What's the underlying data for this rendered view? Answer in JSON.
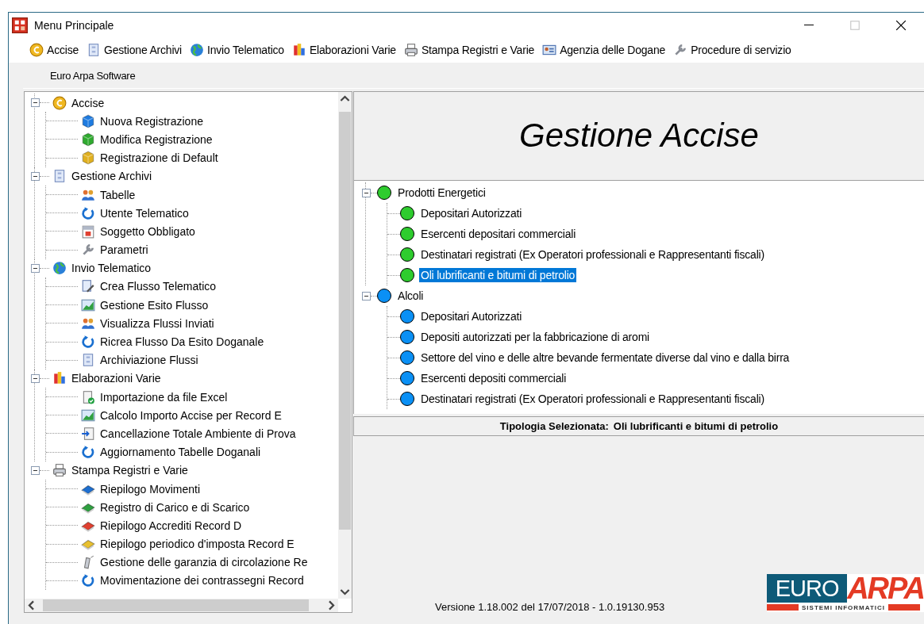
{
  "window": {
    "title": "Menu Principale"
  },
  "menu": [
    "Accise",
    "Gestione Archivi",
    "Invio Telematico",
    "Elaborazioni Varie",
    "Stampa Registri e Varie",
    "Agenzia delle Dogane",
    "Procedure di servizio"
  ],
  "toolbar": {
    "label": "Euro Arpa Software"
  },
  "left_tree": [
    {
      "label": "Accise",
      "expanded": true,
      "children": [
        "Nuova Registrazione",
        "Modifica Registrazione",
        "Registrazione di Default"
      ]
    },
    {
      "label": "Gestione Archivi",
      "expanded": true,
      "children": [
        "Tabelle",
        "Utente Telematico",
        "Soggetto Obbligato",
        "Parametri"
      ]
    },
    {
      "label": "Invio Telematico",
      "expanded": true,
      "children": [
        "Crea Flusso Telematico",
        "Gestione Esito Flusso",
        "Visualizza Flussi Inviati",
        "Ricrea Flusso Da Esito Doganale",
        "Archiviazione Flussi"
      ]
    },
    {
      "label": "Elaborazioni Varie",
      "expanded": true,
      "children": [
        "Importazione da file Excel",
        "Calcolo Importo Accise per Record E",
        "Cancellazione Totale Ambiente di Prova",
        "Aggiornamento Tabelle Doganali"
      ]
    },
    {
      "label": "Stampa Registri e Varie",
      "expanded": true,
      "children": [
        "Riepilogo Movimenti",
        "Registro di Carico e di Scarico",
        "Riepilogo Accrediti Record D",
        "Riepilogo periodico d'imposta Record E",
        "Gestione delle garanzia di circolazione Re",
        "Movimentazione dei contrassegni Record"
      ]
    }
  ],
  "header": {
    "title": "Gestione Accise"
  },
  "right_tree": [
    {
      "label": "Prodotti Energetici",
      "color": "#2ecc2e",
      "expanded": true,
      "children": [
        {
          "label": "Depositari Autorizzati",
          "selected": false
        },
        {
          "label": "Esercenti depositari commerciali",
          "selected": false
        },
        {
          "label": "Destinatari registrati (Ex Operatori professionali e Rappresentanti fiscali)",
          "selected": false
        },
        {
          "label": "Oli lubrificanti e bitumi di petrolio",
          "selected": true
        }
      ]
    },
    {
      "label": "Alcoli",
      "color": "#0a90f5",
      "expanded": true,
      "children": [
        {
          "label": "Depositari Autorizzati",
          "selected": false
        },
        {
          "label": "Depositi autorizzati per la fabbricazione di aromi",
          "selected": false
        },
        {
          "label": "Settore del vino e delle altre bevande fermentate diverse dal vino e dalla birra",
          "selected": false
        },
        {
          "label": "Esercenti depositi commerciali",
          "selected": false
        },
        {
          "label": "Destinatari registrati (Ex Operatori professionali e Rappresentanti fiscali)",
          "selected": false
        }
      ]
    }
  ],
  "status": {
    "label": "Tipologia Selezionata:",
    "value": "Oli lubrificanti e bitumi di petrolio"
  },
  "version": "Versione 1.18.002 del 17/07/2018 - 1.0.19130.953",
  "logo": {
    "left": "EURO",
    "right": "ARPA",
    "tagline": "SISTEMI INFORMATICI"
  }
}
